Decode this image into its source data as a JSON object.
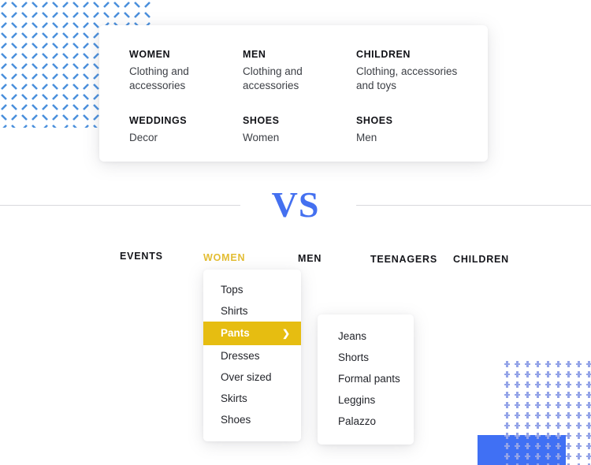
{
  "colors": {
    "accent_blue": "#4470f0",
    "accent_gold": "#e6bd11",
    "nav_active_gold": "#e3bd33",
    "pattern_blue": "#4a8fdc",
    "pattern_dot": "#9aa0d8",
    "block_blue": "#4070f4",
    "rule_grey": "#d9d9dd",
    "text_dark": "#15161b"
  },
  "mega_menu": {
    "columns": [
      {
        "title": "WOMEN",
        "description": "Clothing and accessories"
      },
      {
        "title": "MEN",
        "description": "Clothing and accessories"
      },
      {
        "title": "CHILDREN",
        "description": "Clothing, accessories and toys"
      },
      {
        "title": "WEDDINGS",
        "description": "Decor"
      },
      {
        "title": "SHOES",
        "description": "Women"
      },
      {
        "title": "SHOES",
        "description": "Men"
      }
    ]
  },
  "divider": {
    "label": "VS"
  },
  "nav": {
    "items": [
      {
        "label": "EVENTS",
        "active": false
      },
      {
        "label": "WOMEN",
        "active": true
      },
      {
        "label": "MEN",
        "active": false
      },
      {
        "label": "TEENAGERS",
        "active": false
      },
      {
        "label": "CHILDREN",
        "active": false
      }
    ]
  },
  "dropdown": {
    "items": [
      {
        "label": "Tops",
        "highlighted": false,
        "has_submenu": false
      },
      {
        "label": "Shirts",
        "highlighted": false,
        "has_submenu": false
      },
      {
        "label": "Pants",
        "highlighted": true,
        "has_submenu": true
      },
      {
        "label": "Dresses",
        "highlighted": false,
        "has_submenu": false
      },
      {
        "label": "Over sized",
        "highlighted": false,
        "has_submenu": false
      },
      {
        "label": "Skirts",
        "highlighted": false,
        "has_submenu": false
      },
      {
        "label": "Shoes",
        "highlighted": false,
        "has_submenu": false
      }
    ],
    "chevron_glyph": "❯"
  },
  "submenu": {
    "items": [
      {
        "label": "Jeans"
      },
      {
        "label": "Shorts"
      },
      {
        "label": "Formal pants"
      },
      {
        "label": "Leggins"
      },
      {
        "label": "Palazzo"
      }
    ]
  },
  "decorations": {
    "top_left_pattern": "diagonal-dash-pattern",
    "bottom_right_pattern": "dot-grid-pattern",
    "bottom_right_block": "blue-rectangle"
  }
}
